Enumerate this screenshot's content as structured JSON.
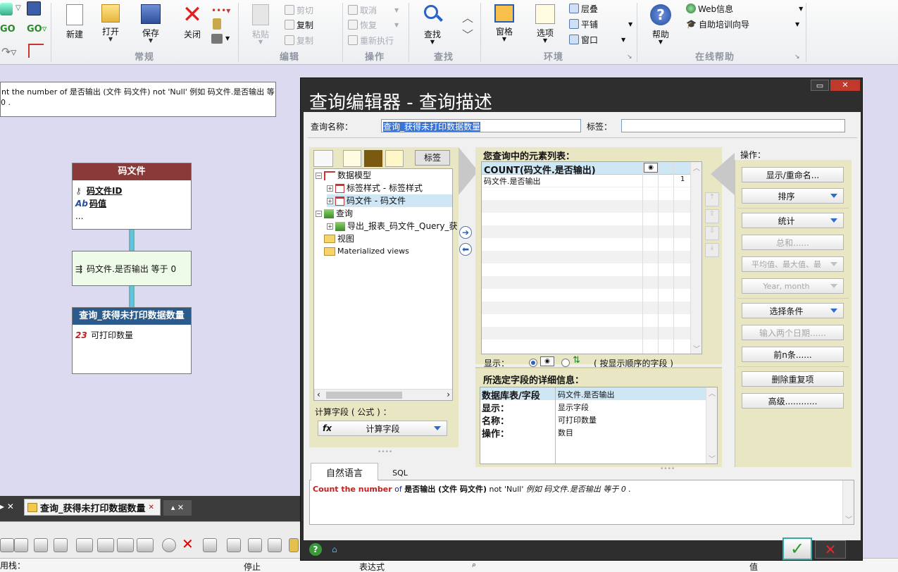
{
  "ribbon": {
    "groups": {
      "regular": "常规",
      "edit": "编辑",
      "operate": "操作",
      "find": "查找",
      "env": "环境",
      "help": "在线帮助"
    },
    "buttons": {
      "new": "新建",
      "open": "打开",
      "save": "保存",
      "close": "关闭",
      "paste": "粘贴",
      "cut": "剪切",
      "copy1": "复制",
      "copy2": "复制",
      "cancel": "取消",
      "restore": "恢复",
      "redo": "重新执行",
      "find": "查找",
      "window": "窗格",
      "options": "选项",
      "cascade": "层叠",
      "tile": "平铺",
      "win": "窗口",
      "help": "帮助",
      "web": "Web信息",
      "guide": "自助培训向导"
    }
  },
  "canvas": {
    "note_line1": "unt the number of 是否输出 (文件 码文件)  not 'Null'  例如 码文件.是否输出  等",
    "note_line2": "0 .",
    "node1_title": "码文件",
    "node1_field1": "码文件ID",
    "node1_field2": "码值",
    "node1_more": "...",
    "node2_text": "码文件.是否输出  等于 0",
    "node3_title": "查询_获得未打印数据数量",
    "node3_badge": "23",
    "node3_field": "可打印数量"
  },
  "taskbar": {
    "tab_label": "查询_获得未打印数据数量"
  },
  "bottom": {
    "left_label": "用栈：",
    "col_stop": "停止",
    "col_expr": "表达式",
    "col_value": "值"
  },
  "dialog": {
    "title": "查询编辑器 - 查询描述",
    "query_name_label": "查询名称：",
    "query_name_value": "查询_获得未打印数据数量",
    "tag_label": "标签：",
    "tag_value": "",
    "tree_tab_label": "标签",
    "tree": [
      "数据模型",
      "标签样式 - 标签样式",
      "码文件 - 码文件",
      "查询",
      "导出_报表_码文件_Query_获",
      "视图",
      "Materialized views"
    ],
    "calc_label": "计算字段 ( 公式 ) ：",
    "calc_button": "计算字段",
    "elements_header": "您查询中的元素列表：",
    "elements_col_title": "COUNT(码文件.是否输出)",
    "elements_row_name": "码文件.是否输出",
    "elements_row_order": "1",
    "show_label": "显示：",
    "show_hint": "( 按显示顺序的字段 )",
    "details_header": "所选定字段的详细信息：",
    "details": [
      {
        "k": "数据库表/字段",
        "v": "码文件.是否输出"
      },
      {
        "k": "显示：",
        "v": "显示字段"
      },
      {
        "k": "名称：",
        "v": "可打印数量"
      },
      {
        "k": "操作：",
        "v": "数目"
      }
    ],
    "ops_label": "操作：",
    "ops": {
      "show_rename": "显示/重命名...",
      "sort": "排序",
      "stats": "统计",
      "sum": "总和......",
      "avg": "平均值、最大值、最",
      "year_month": "Year, month",
      "select_cond": "选择条件",
      "two_dates": "输入两个日期......",
      "top_n": "前n条......",
      "dedupe": "删除重复项",
      "advanced": "高级............"
    },
    "tabs": {
      "natural": "自然语言",
      "sql": "SQL"
    },
    "nl": {
      "p1": "Count the number",
      "p2": " of ",
      "p3": "是否输出 (文件 码文件)",
      "p4": " not 'Null'  ",
      "p5": "例如 码文件.是否输出  等于 0 ."
    }
  },
  "colors": {
    "node1_head": "#8b3a3a",
    "node3_head": "#2a5b8c",
    "panel_yellow": "#e9e7c3",
    "selected_row": "#cfe6f4",
    "dialog_dark": "#2e2e2e"
  }
}
